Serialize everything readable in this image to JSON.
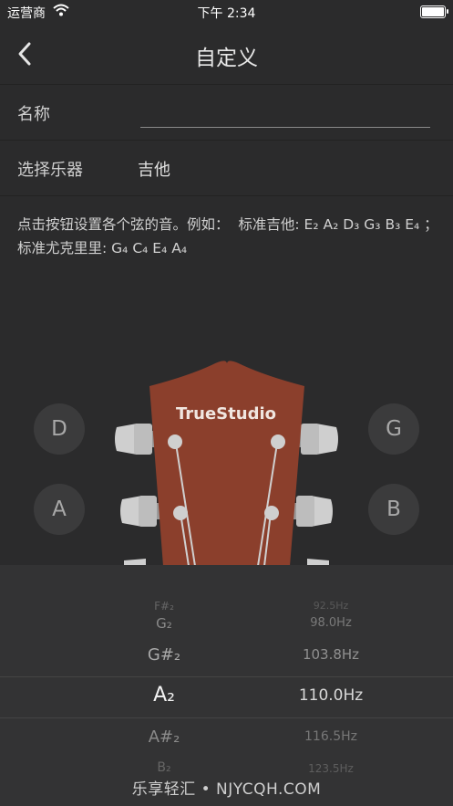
{
  "status_bar": {
    "carrier": "运营商",
    "time": "下午 2:34"
  },
  "nav": {
    "title": "自定义"
  },
  "form": {
    "name_label": "名称",
    "name_value": "",
    "instrument_label": "选择乐器",
    "instrument_value": "吉他"
  },
  "description": {
    "line1_prefix": "点击按钮设置各个弦的音。例如：",
    "guitar_label": "标准吉他:",
    "guitar_notes": "E₂ A₂ D₃ G₃ B₃ E₄",
    "separator": "；",
    "ukulele_label": "标准尤克里里:",
    "ukulele_notes": "G₄ C₄ E₄ A₄"
  },
  "headstock": {
    "brand": "TrueStudio"
  },
  "string_buttons": [
    {
      "id": "d",
      "label": "D"
    },
    {
      "id": "g",
      "label": "G"
    },
    {
      "id": "a",
      "label": "A"
    },
    {
      "id": "b",
      "label": "B"
    }
  ],
  "picker": {
    "selected_index": 3,
    "items": [
      {
        "note": "F#₂",
        "freq": "92.5Hz"
      },
      {
        "note": "G₂",
        "freq": "98.0Hz"
      },
      {
        "note": "G#₂",
        "freq": "103.8Hz"
      },
      {
        "note": "A₂",
        "freq": "110.0Hz"
      },
      {
        "note": "A#₂",
        "freq": "116.5Hz"
      },
      {
        "note": "B₂",
        "freq": "123.5Hz"
      }
    ]
  },
  "watermark": "乐享轻汇 • NJYCQH.COM",
  "colors": {
    "background": "#2b2b2c",
    "headstock": "#8b3f2c",
    "picker": "#333334"
  }
}
